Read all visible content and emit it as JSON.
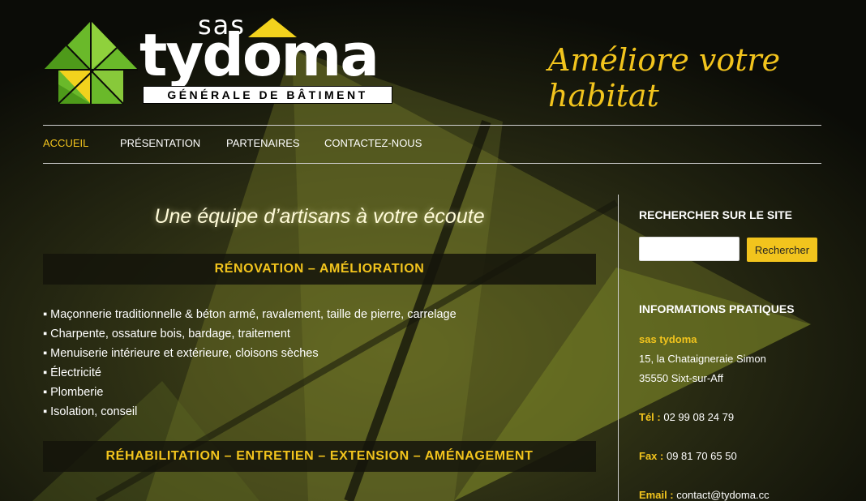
{
  "header": {
    "logo_prefix": "sas",
    "logo_name": "tydoma",
    "logo_subtitle": "GÉNÉRALE DE BÂTIMENT",
    "tagline": "Améliore votre habitat"
  },
  "nav": {
    "items": [
      {
        "label": "ACCUEIL"
      },
      {
        "label": "PRÉSENTATION"
      },
      {
        "label": "PARTENAIRES"
      },
      {
        "label": "CONTACTEZ-NOUS"
      }
    ]
  },
  "main": {
    "heading": "Une équipe d’artisans à votre écoute",
    "sections": [
      {
        "title": "RÉNOVATION – AMÉLIORATION"
      },
      {
        "title": "RÉHABILITATION – ENTRETIEN – EXTENSION – AMÉNAGEMENT"
      }
    ],
    "bullet": "▪",
    "items": [
      "Maçonnerie traditionnelle & béton armé, ravalement, taille de pierre, carrelage",
      "Charpente, ossature bois, bardage, traitement",
      "Menuiserie intérieure et extérieure, cloisons sèches",
      "Électricité",
      "Plomberie",
      "Isolation, conseil"
    ]
  },
  "sidebar": {
    "search_title": "RECHERCHER SUR LE SITE",
    "search_placeholder": "",
    "search_button": "Rechercher",
    "info_title": "INFORMATIONS PRATIQUES",
    "company": "sas tydoma",
    "address_line1": "15, la Chataigneraie Simon",
    "address_line2": "35550 Sixt-sur-Aff",
    "tel_label": "Tél :",
    "tel": "02 99 08 24 79",
    "fax_label": "Fax :",
    "fax": "09 81 70 65 50",
    "email_label": "Email :",
    "email": "contact@tydoma.cc"
  },
  "colors": {
    "accent": "#f2c41d",
    "background": "#0b0c07",
    "logo_green": "#6ab92a",
    "logo_yellow": "#f2d21d"
  }
}
